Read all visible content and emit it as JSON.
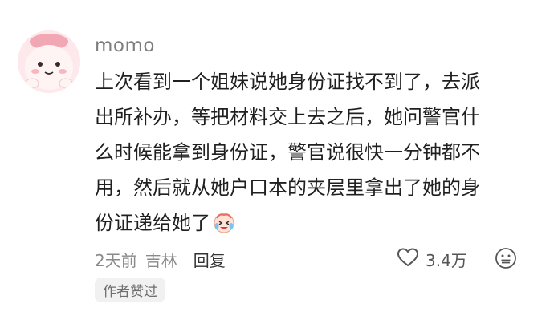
{
  "comment": {
    "username": "momo",
    "lines": [
      "上次看到一个姐妹说她身份证找不到了，去派",
      "出所补办，等把材料交上去之后，她问警官什",
      "么时候能拿到身份证，警官说很快一分钟都不",
      "用，然后就从她户口本的夹层里拿出了她的身",
      "份证递给她了"
    ],
    "time": "2天前",
    "location": "吉林",
    "reply_label": "回复",
    "like_count": "3.4万",
    "author_badge": "作者赞过"
  },
  "icons": {
    "avatar": "pink-cartoon-avatar",
    "emoji": "crying-laughing-emoji",
    "like": "heart-outline-icon",
    "react": "smiley-face-icon"
  },
  "colors": {
    "text": "#1f1f1f",
    "username": "#7d7d7d",
    "meta": "#8a8a8a",
    "badge_bg": "#f1f1f1"
  }
}
